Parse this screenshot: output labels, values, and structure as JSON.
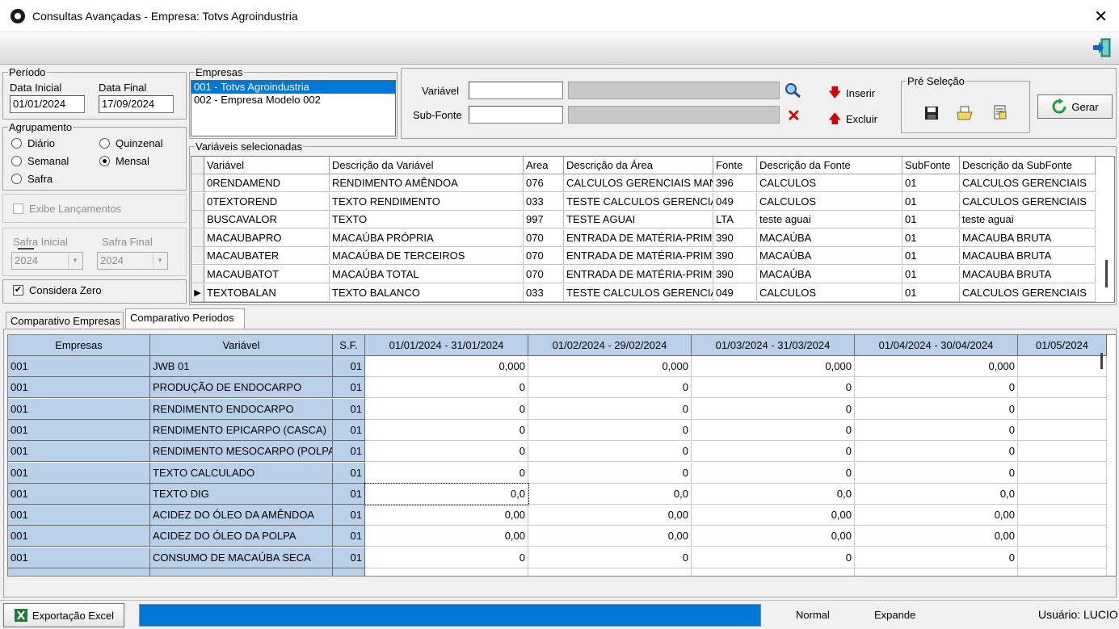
{
  "window": {
    "title": "Consultas Avançadas  -  Empresa: Totvs Agroindustria"
  },
  "periodo": {
    "legend": "Período",
    "data_inicial_label": "Data Inicial",
    "data_final_label": "Data Final",
    "data_inicial": "01/01/2024",
    "data_final": "17/09/2024"
  },
  "agrupamento": {
    "legend": "Agrupamento",
    "options": [
      "Diário",
      "Quinzenal",
      "Semanal",
      "Mensal",
      "Safra"
    ],
    "selected": "Mensal"
  },
  "exibe_lancamentos": {
    "label": "Exibe Lançamentos",
    "checked": false
  },
  "safra": {
    "inicial_label": "Safra Inicial",
    "final_label": "Safra Final",
    "inicial": "2024",
    "final": "2024"
  },
  "considera_zero": {
    "label": "Considera Zero",
    "checked": true
  },
  "empresas": {
    "legend": "Empresas",
    "items": [
      "001 - Totvs Agroindustria",
      "002 - Empresa Modelo 002"
    ]
  },
  "filtro": {
    "variavel_label": "Variável",
    "subfonte_label": "Sub-Fonte",
    "inserir": "Inserir",
    "excluir": "Excluir"
  },
  "pre_selecao": {
    "legend": "Pré Seleção"
  },
  "gerar": "Gerar",
  "variaveis": {
    "legend": "Variáveis selecionadas",
    "columns": [
      "Variável",
      "Descrição da Variável",
      "Area",
      "Descrição da Área",
      "Fonte",
      "Descrição da Fonte",
      "SubFonte",
      "Descrição da SubFonte"
    ],
    "rows": [
      [
        "0RENDAMEND",
        "RENDIMENTO AMÊNDOA",
        "076",
        "CALCULOS GERENCIAIS MAN",
        "396",
        "CALCULOS",
        "01",
        "CALCULOS GERENCIAIS"
      ],
      [
        "0TEXTOREND",
        "TEXTO RENDIMENTO",
        "033",
        "TESTE CALCULOS GERENCIA",
        "049",
        "CALCULOS",
        "01",
        "CALCULOS GERENCIAIS"
      ],
      [
        "BUSCAVALOR",
        "TEXTO",
        "997",
        "TESTE AGUAI",
        "LTA",
        "teste aguai",
        "01",
        "teste aguai"
      ],
      [
        "MACAUBAPRO",
        "MACAÚBA PRÓPRIA",
        "070",
        "ENTRADA DE MATÉRIA-PRIM",
        "390",
        "MACAÚBA",
        "01",
        "MACAUBA BRUTA"
      ],
      [
        "MACAUBATER",
        "MACAÚBA DE TERCEIROS",
        "070",
        "ENTRADA DE MATÉRIA-PRIM",
        "390",
        "MACAÚBA",
        "01",
        "MACAUBA BRUTA"
      ],
      [
        "MACAUBATOT",
        "MACAÚBA TOTAL",
        "070",
        "ENTRADA DE MATÉRIA-PRIM",
        "390",
        "MACAÚBA",
        "01",
        "MACAUBA BRUTA"
      ],
      [
        "TEXTOBALAN",
        "TEXTO BALANCO",
        "033",
        "TESTE CALCULOS GERENCIA",
        "049",
        "CALCULOS",
        "01",
        "CALCULOS GERENCIAIS"
      ]
    ]
  },
  "tabs": [
    "Comparativo Empresas",
    "Comparativo Periodos"
  ],
  "comparativo": {
    "columns": [
      "Empresas",
      "Variável",
      "S.F.",
      "01/01/2024 - 31/01/2024",
      "01/02/2024 - 29/02/2024",
      "01/03/2024 - 31/03/2024",
      "01/04/2024 - 30/04/2024",
      "01/05/2024"
    ],
    "rows": [
      [
        "001",
        "JWB 01",
        "01",
        "0,000",
        "0,000",
        "0,000",
        "0,000"
      ],
      [
        "001",
        "PRODUÇÃO DE ENDOCARPO",
        "01",
        "0",
        "0",
        "0",
        "0"
      ],
      [
        "001",
        "RENDIMENTO ENDOCARPO",
        "01",
        "0",
        "0",
        "0",
        "0"
      ],
      [
        "001",
        "RENDIMENTO EPICARPO (CASCA)",
        "01",
        "0",
        "0",
        "0",
        "0"
      ],
      [
        "001",
        "RENDIMENTO MESOCARPO (POLPA)",
        "01",
        "0",
        "0",
        "0",
        "0"
      ],
      [
        "001",
        "TEXTO CALCULADO",
        "01",
        "0",
        "0",
        "0",
        "0"
      ],
      [
        "001",
        "TEXTO DIG",
        "01",
        "0,0",
        "0,0",
        "0,0",
        "0,0"
      ],
      [
        "001",
        "ACIDEZ DO ÓLEO DA AMÊNDOA",
        "01",
        "0,00",
        "0,00",
        "0,00",
        "0,00"
      ],
      [
        "001",
        "ACIDEZ DO ÓLEO DA POLPA",
        "01",
        "0,00",
        "0,00",
        "0,00",
        "0,00"
      ],
      [
        "001",
        "CONSUMO DE MACAÚBA SECA",
        "01",
        "0",
        "0",
        "0",
        "0"
      ]
    ]
  },
  "status": {
    "export_label": "Exportação Excel",
    "progress": 1.0,
    "mode": "Normal",
    "expand": "Expande",
    "user": "Usuário: LUCIO"
  }
}
